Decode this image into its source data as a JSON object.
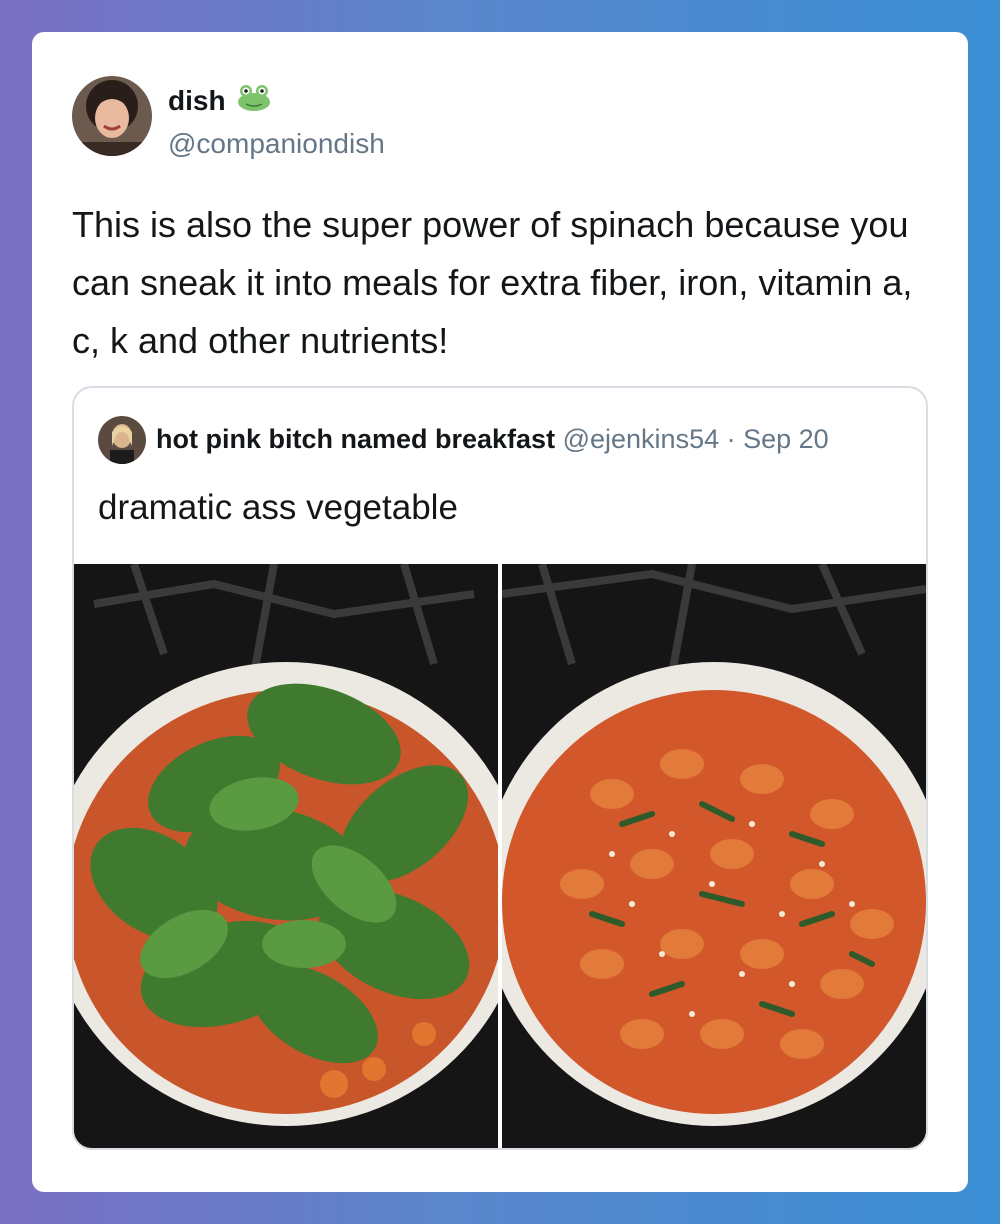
{
  "author": {
    "display_name": "dish",
    "emoji": "frog-emoji-icon",
    "handle": "@companiondish"
  },
  "tweet": {
    "text": "This is also the super power of spinach because you can sneak it into meals for extra fiber, iron, vitamin a, c, k and other nutrients!"
  },
  "quoted": {
    "display_name": "hot pink bitch named breakfast",
    "meta": "@ejenkins54 · Sep 20",
    "text": "dramatic ass vegetable",
    "images": [
      "pan-with-raw-spinach-photo",
      "cooked-gnocchi-with-spinach-photo"
    ]
  },
  "colors": {
    "text": "#14171a",
    "secondary": "#657786",
    "border": "#d7dde2",
    "background_gradient_start": "#7b6fc4",
    "background_gradient_end": "#3b8fd4"
  }
}
